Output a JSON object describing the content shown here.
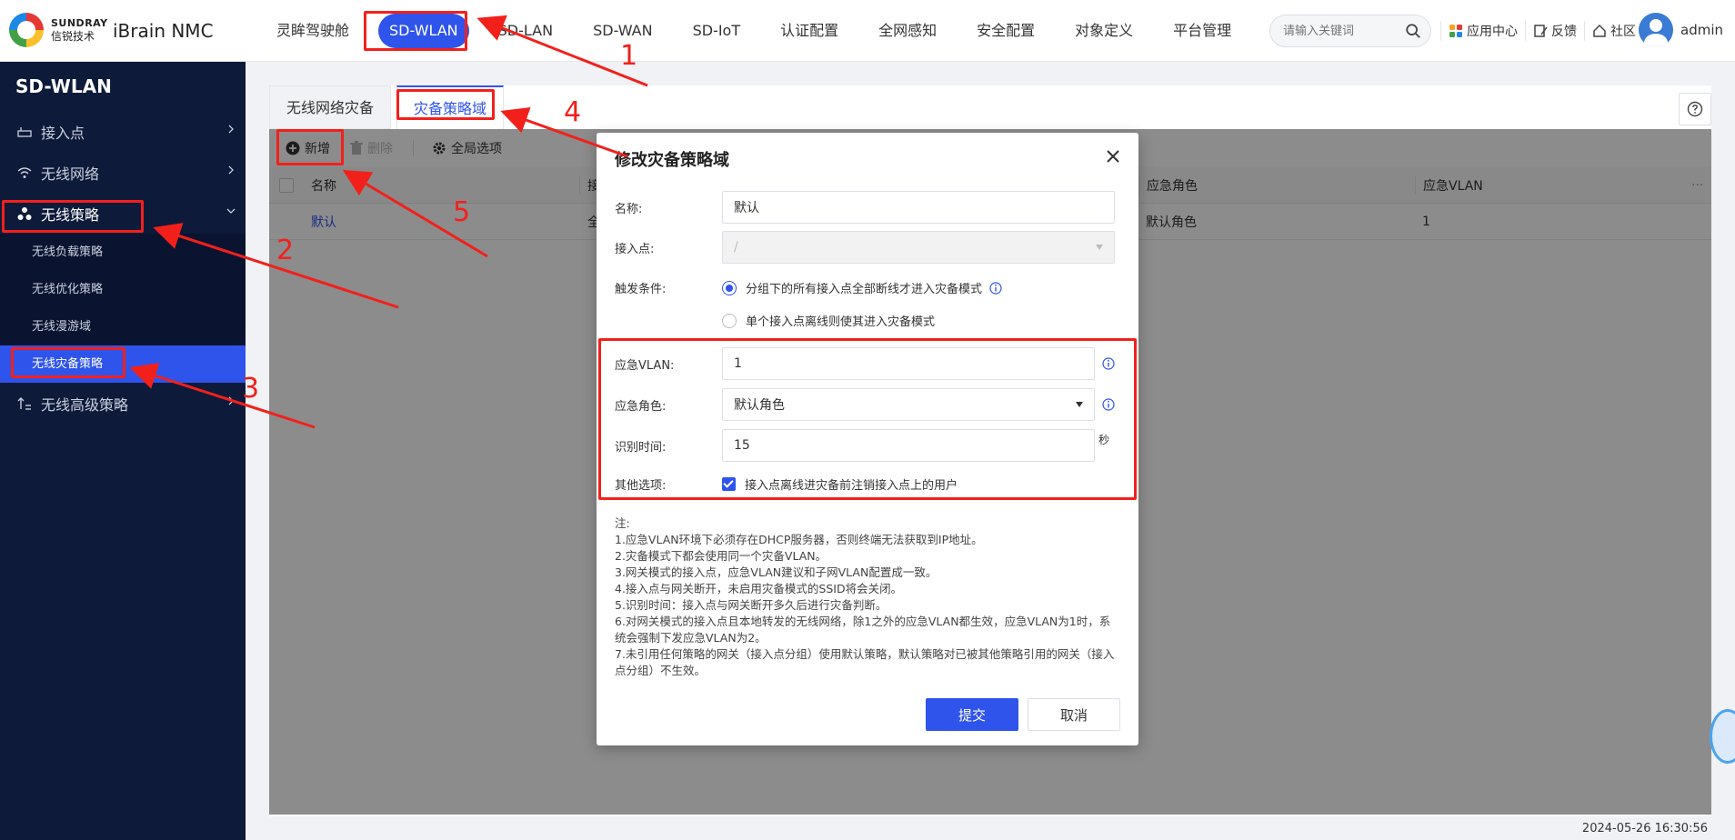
{
  "brand": {
    "en": "SUNDRAY",
    "cn": "信锐技术",
    "product": "iBrain NMC"
  },
  "topnav": [
    {
      "label": "灵眸驾驶舱",
      "active": false
    },
    {
      "label": "SD-WLAN",
      "active": true
    },
    {
      "label": "SD-LAN",
      "active": false
    },
    {
      "label": "SD-WAN",
      "active": false
    },
    {
      "label": "SD-IoT",
      "active": false
    },
    {
      "label": "认证配置",
      "active": false
    },
    {
      "label": "全网感知",
      "active": false
    },
    {
      "label": "安全配置",
      "active": false
    },
    {
      "label": "对象定义",
      "active": false
    },
    {
      "label": "平台管理",
      "active": false
    }
  ],
  "search": {
    "placeholder": "请输入关键词"
  },
  "tools": {
    "app_center": "应用中心",
    "feedback": "反馈",
    "community": "社区"
  },
  "user": {
    "name": "admin"
  },
  "sidebar": {
    "title": "SD-WLAN",
    "items": [
      {
        "label": "接入点",
        "icon": "access-point-icon"
      },
      {
        "label": "无线网络",
        "icon": "wifi-icon"
      },
      {
        "label": "无线策略",
        "icon": "policy-icon"
      },
      {
        "label": "无线高级策略",
        "icon": "advanced-icon"
      }
    ],
    "sub_items": [
      {
        "label": "无线负载策略",
        "active": false
      },
      {
        "label": "无线优化策略",
        "active": false
      },
      {
        "label": "无线漫游域",
        "active": false
      },
      {
        "label": "无线灾备策略",
        "active": true
      }
    ]
  },
  "tabs": [
    {
      "label": "无线网络灾备",
      "active": false
    },
    {
      "label": "灾备策略域",
      "active": true
    }
  ],
  "toolbar": {
    "add": "新增",
    "delete": "删除",
    "global": "全局选项"
  },
  "table": {
    "headers": {
      "name": "名称",
      "ap": "接",
      "role": "应急角色",
      "vlan": "应急VLAN",
      "more": "···"
    },
    "rows": [
      {
        "name": "默认",
        "ap": "全",
        "role": "默认角色",
        "vlan": "1"
      }
    ]
  },
  "modal": {
    "title": "修改灾备策略域",
    "name_label": "名称:",
    "name_value": "默认",
    "ap_label": "接入点:",
    "ap_value": "/",
    "trigger_label": "触发条件:",
    "trigger_opt1": "分组下的所有接入点全部断线才进入灾备模式",
    "trigger_opt2": "单个接入点离线则使其进入灾备模式",
    "vlan_label": "应急VLAN:",
    "vlan_value": "1",
    "role_label": "应急角色:",
    "role_value": "默认角色",
    "time_label": "识别时间:",
    "time_value": "15",
    "time_unit": "秒",
    "other_label": "其他选项:",
    "other_opt": "接入点离线进灾备前注销接入点上的用户",
    "notes": [
      "注:",
      "1.应急VLAN环境下必须存在DHCP服务器，否则终端无法获取到IP地址。",
      "2.灾备模式下都会使用同一个灾备VLAN。",
      "3.网关模式的接入点，应急VLAN建议和子网VLAN配置成一致。",
      "4.接入点与网关断开，未启用灾备模式的SSID将会关闭。",
      "5.识别时间：接入点与网关断开多久后进行灾备判断。",
      "6.对网关模式的接入点且本地转发的无线网络，除1之外的应急VLAN都生效，应急VLAN为1时，系统会强制下发应急VLAN为2。",
      "7.未引用任何策略的网关（接入点分组）使用默认策略，默认策略对已被其他策略引用的网关（接入点分组）不生效。"
    ],
    "submit": "提交",
    "cancel": "取消"
  },
  "timestamp": "2024-05-26 16:30:56",
  "annotations": [
    "1",
    "2",
    "3",
    "4",
    "5"
  ],
  "colors": {
    "accent": "#2f54eb",
    "sidebar_bg": "#0e1a3a",
    "annotation": "#f2201b"
  }
}
